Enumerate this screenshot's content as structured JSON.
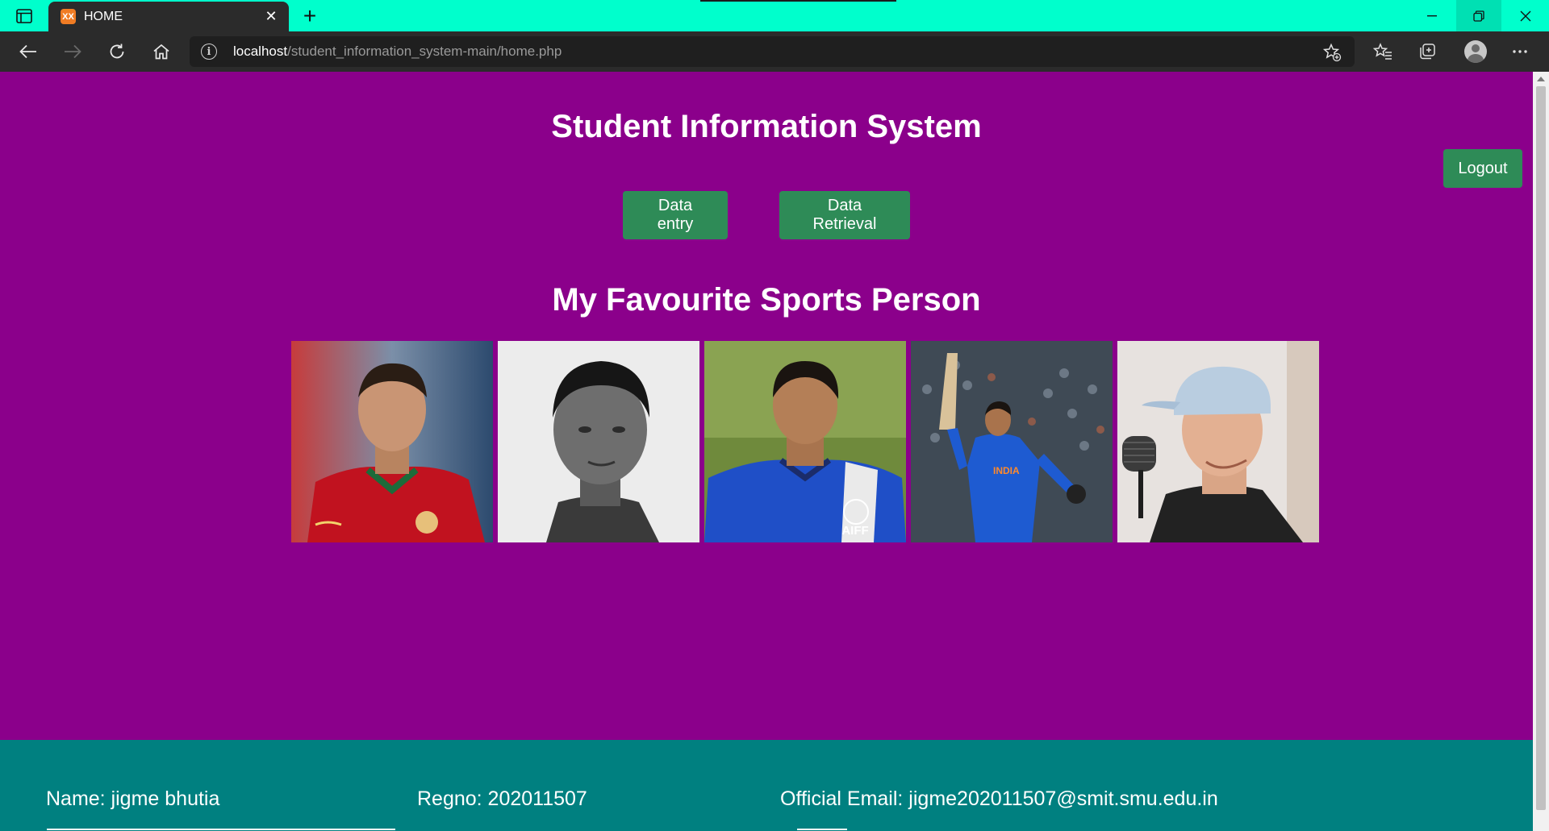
{
  "browser": {
    "tab_title": "HOME",
    "tab_favicon_text": "XX",
    "url_host": "localhost",
    "url_path": "/student_information_system-main/home.php",
    "icons": [
      "tab-actions-icon",
      "close-icon",
      "plus-icon",
      "minimize-icon",
      "restore-icon",
      "back-icon",
      "forward-icon",
      "refresh-icon",
      "home-icon",
      "info-icon",
      "add-favorite-icon",
      "favorites-icon",
      "collections-icon",
      "profile-icon",
      "more-icon"
    ]
  },
  "page": {
    "title": "Student Information System",
    "logout_label": "Logout",
    "buttons": {
      "data_entry": "Data entry",
      "data_retrieval": "Data Retrieval"
    },
    "sports_title": "My Favourite Sports Person",
    "photos": [
      {
        "name": "photo-footballer-red-jersey"
      },
      {
        "name": "photo-boxer-black-white"
      },
      {
        "name": "photo-footballer-blue-jersey",
        "caption": "AIFF"
      },
      {
        "name": "photo-cricketer-blue-jersey"
      },
      {
        "name": "photo-man-with-cap"
      }
    ]
  },
  "footer": {
    "name": "Name: jigme bhutia",
    "regno": "Regno: 202011507",
    "email": "Official Email: jigme202011507@smit.smu.edu.in"
  },
  "colors": {
    "titlebar": "#00ffcc",
    "chrome": "#2b2b2b",
    "page_bg": "#8b008b",
    "button": "#2e8b57",
    "footer_bg": "#008080"
  }
}
